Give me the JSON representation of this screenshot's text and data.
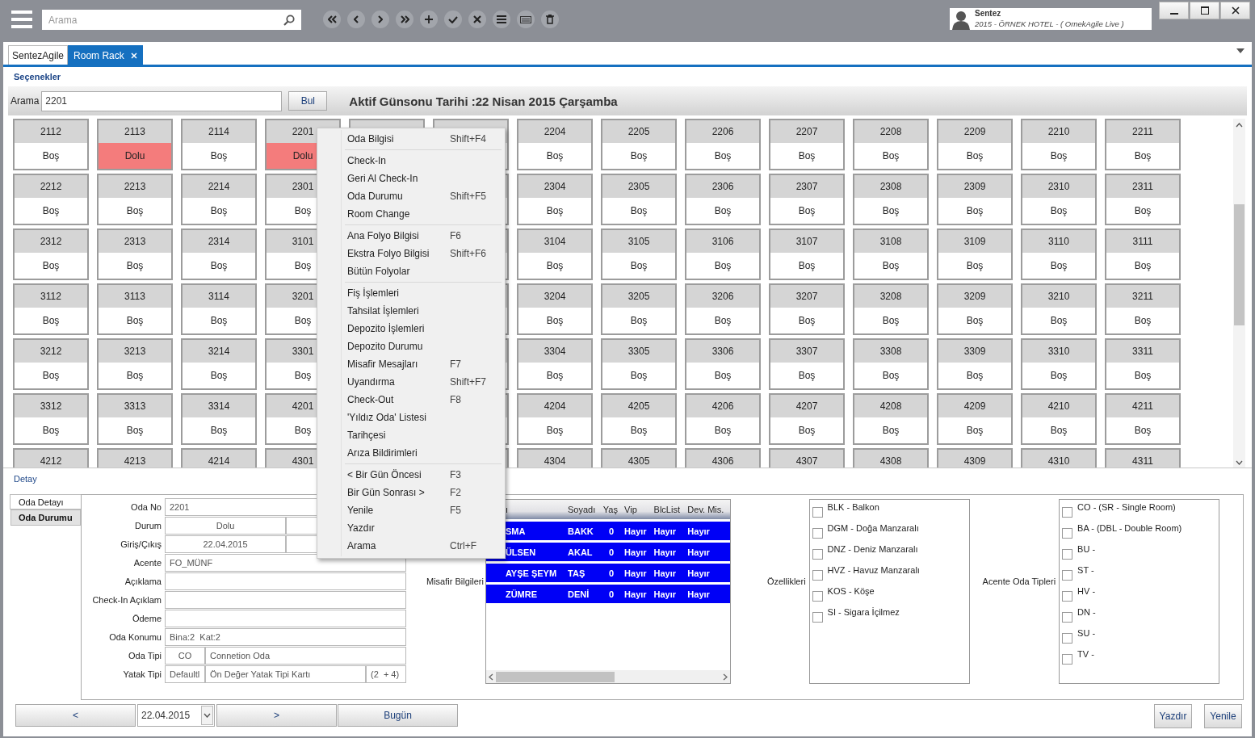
{
  "top_bar": {
    "search_placeholder": "Arama",
    "user": {
      "name": "Sentez",
      "context": "2015 - ÖRNEK HOTEL - ( OrnekAgile Live )"
    }
  },
  "tabs": [
    {
      "label": "SentezAgile",
      "selected": false,
      "closable": false
    },
    {
      "label": "Room Rack",
      "selected": true,
      "closable": true
    }
  ],
  "options_link": "Seçenekler",
  "search": {
    "label": "Arama",
    "value": "2201",
    "button": "Bul"
  },
  "active_date": "Aktif Günsonu Tarihi :22 Nisan 2015 Çarşamba",
  "room_rows": [
    [
      {
        "kind": "room",
        "number": "2112",
        "status": "Boş",
        "occupied": false
      },
      {
        "kind": "room",
        "number": "2113",
        "status": "Dolu",
        "occupied": true
      },
      {
        "kind": "room",
        "number": "2114",
        "status": "Boş",
        "occupied": false
      },
      {
        "kind": "room",
        "number": "2201",
        "status": "Dolu",
        "occupied": true
      },
      {
        "kind": "covered"
      },
      {
        "kind": "covered"
      },
      {
        "kind": "room",
        "number": "2204",
        "status": "Boş",
        "occupied": false
      },
      {
        "kind": "room",
        "number": "2205",
        "status": "Boş",
        "occupied": false
      },
      {
        "kind": "room",
        "number": "2206",
        "status": "Boş",
        "occupied": false
      },
      {
        "kind": "room",
        "number": "2207",
        "status": "Boş",
        "occupied": false
      },
      {
        "kind": "room",
        "number": "2208",
        "status": "Boş",
        "occupied": false
      },
      {
        "kind": "room",
        "number": "2209",
        "status": "Boş",
        "occupied": false
      },
      {
        "kind": "room",
        "number": "2210",
        "status": "Boş",
        "occupied": false
      },
      {
        "kind": "room",
        "number": "2211",
        "status": "Boş",
        "occupied": false
      }
    ],
    [
      {
        "kind": "room",
        "number": "2212",
        "status": "Boş",
        "occupied": false
      },
      {
        "kind": "room",
        "number": "2213",
        "status": "Boş",
        "occupied": false
      },
      {
        "kind": "room",
        "number": "2214",
        "status": "Boş",
        "occupied": false
      },
      {
        "kind": "room",
        "number": "2301",
        "status": "Boş",
        "occupied": false
      },
      {
        "kind": "hidden"
      },
      {
        "kind": "covered"
      },
      {
        "kind": "room",
        "number": "2304",
        "status": "Boş",
        "occupied": false
      },
      {
        "kind": "room",
        "number": "2305",
        "status": "Boş",
        "occupied": false
      },
      {
        "kind": "room",
        "number": "2306",
        "status": "Boş",
        "occupied": false
      },
      {
        "kind": "room",
        "number": "2307",
        "status": "Boş",
        "occupied": false
      },
      {
        "kind": "room",
        "number": "2308",
        "status": "Boş",
        "occupied": false
      },
      {
        "kind": "room",
        "number": "2309",
        "status": "Boş",
        "occupied": false
      },
      {
        "kind": "room",
        "number": "2310",
        "status": "Boş",
        "occupied": false
      },
      {
        "kind": "room",
        "number": "2311",
        "status": "Boş",
        "occupied": false
      }
    ],
    [
      {
        "kind": "room",
        "number": "2312",
        "status": "Boş",
        "occupied": false
      },
      {
        "kind": "room",
        "number": "2313",
        "status": "Boş",
        "occupied": false
      },
      {
        "kind": "room",
        "number": "2314",
        "status": "Boş",
        "occupied": false
      },
      {
        "kind": "room",
        "number": "3101",
        "status": "Boş",
        "occupied": false
      },
      {
        "kind": "hidden"
      },
      {
        "kind": "covered"
      },
      {
        "kind": "room",
        "number": "3104",
        "status": "Boş",
        "occupied": false
      },
      {
        "kind": "room",
        "number": "3105",
        "status": "Boş",
        "occupied": false
      },
      {
        "kind": "room",
        "number": "3106",
        "status": "Boş",
        "occupied": false
      },
      {
        "kind": "room",
        "number": "3107",
        "status": "Boş",
        "occupied": false
      },
      {
        "kind": "room",
        "number": "3108",
        "status": "Boş",
        "occupied": false
      },
      {
        "kind": "room",
        "number": "3109",
        "status": "Boş",
        "occupied": false
      },
      {
        "kind": "room",
        "number": "3110",
        "status": "Boş",
        "occupied": false
      },
      {
        "kind": "room",
        "number": "3111",
        "status": "Boş",
        "occupied": false
      }
    ],
    [
      {
        "kind": "room",
        "number": "3112",
        "status": "Boş",
        "occupied": false
      },
      {
        "kind": "room",
        "number": "3113",
        "status": "Boş",
        "occupied": false
      },
      {
        "kind": "room",
        "number": "3114",
        "status": "Boş",
        "occupied": false
      },
      {
        "kind": "room",
        "number": "3201",
        "status": "Boş",
        "occupied": false
      },
      {
        "kind": "hidden"
      },
      {
        "kind": "covered"
      },
      {
        "kind": "room",
        "number": "3204",
        "status": "Boş",
        "occupied": false
      },
      {
        "kind": "room",
        "number": "3205",
        "status": "Boş",
        "occupied": false
      },
      {
        "kind": "room",
        "number": "3206",
        "status": "Boş",
        "occupied": false
      },
      {
        "kind": "room",
        "number": "3207",
        "status": "Boş",
        "occupied": false
      },
      {
        "kind": "room",
        "number": "3208",
        "status": "Boş",
        "occupied": false
      },
      {
        "kind": "room",
        "number": "3209",
        "status": "Boş",
        "occupied": false
      },
      {
        "kind": "room",
        "number": "3210",
        "status": "Boş",
        "occupied": false
      },
      {
        "kind": "room",
        "number": "3211",
        "status": "Boş",
        "occupied": false
      }
    ],
    [
      {
        "kind": "room",
        "number": "3212",
        "status": "Boş",
        "occupied": false
      },
      {
        "kind": "room",
        "number": "3213",
        "status": "Boş",
        "occupied": false
      },
      {
        "kind": "room",
        "number": "3214",
        "status": "Boş",
        "occupied": false
      },
      {
        "kind": "room",
        "number": "3301",
        "status": "Boş",
        "occupied": false
      },
      {
        "kind": "hidden"
      },
      {
        "kind": "covered"
      },
      {
        "kind": "room",
        "number": "3304",
        "status": "Boş",
        "occupied": false
      },
      {
        "kind": "room",
        "number": "3305",
        "status": "Boş",
        "occupied": false
      },
      {
        "kind": "room",
        "number": "3306",
        "status": "Boş",
        "occupied": false
      },
      {
        "kind": "room",
        "number": "3307",
        "status": "Boş",
        "occupied": false
      },
      {
        "kind": "room",
        "number": "3308",
        "status": "Boş",
        "occupied": false
      },
      {
        "kind": "room",
        "number": "3309",
        "status": "Boş",
        "occupied": false
      },
      {
        "kind": "room",
        "number": "3310",
        "status": "Boş",
        "occupied": false
      },
      {
        "kind": "room",
        "number": "3311",
        "status": "Boş",
        "occupied": false
      }
    ],
    [
      {
        "kind": "room",
        "number": "3312",
        "status": "Boş",
        "occupied": false
      },
      {
        "kind": "room",
        "number": "3313",
        "status": "Boş",
        "occupied": false
      },
      {
        "kind": "room",
        "number": "3314",
        "status": "Boş",
        "occupied": false
      },
      {
        "kind": "room",
        "number": "4201",
        "status": "Boş",
        "occupied": false
      },
      {
        "kind": "covered"
      },
      {
        "kind": "covered"
      },
      {
        "kind": "room",
        "number": "4204",
        "status": "Boş",
        "occupied": false
      },
      {
        "kind": "room",
        "number": "4205",
        "status": "Boş",
        "occupied": false
      },
      {
        "kind": "room",
        "number": "4206",
        "status": "Boş",
        "occupied": false
      },
      {
        "kind": "room",
        "number": "4207",
        "status": "Boş",
        "occupied": false
      },
      {
        "kind": "room",
        "number": "4208",
        "status": "Boş",
        "occupied": false
      },
      {
        "kind": "room",
        "number": "4209",
        "status": "Boş",
        "occupied": false
      },
      {
        "kind": "room",
        "number": "4210",
        "status": "Boş",
        "occupied": false
      },
      {
        "kind": "room",
        "number": "4211",
        "status": "Boş",
        "occupied": false
      }
    ],
    [
      {
        "kind": "room",
        "number": "4212"
      },
      {
        "kind": "room",
        "number": "4213"
      },
      {
        "kind": "room",
        "number": "4214"
      },
      {
        "kind": "room",
        "number": "4301"
      },
      {
        "kind": "covered"
      },
      {
        "kind": "covered"
      },
      {
        "kind": "room",
        "number": "4304"
      },
      {
        "kind": "room",
        "number": "4305"
      },
      {
        "kind": "room",
        "number": "4306"
      },
      {
        "kind": "room",
        "number": "4307"
      },
      {
        "kind": "room",
        "number": "4308"
      },
      {
        "kind": "room",
        "number": "4309"
      },
      {
        "kind": "room",
        "number": "4310"
      },
      {
        "kind": "room",
        "number": "4311"
      }
    ]
  ],
  "context_menu": [
    [
      {
        "label": "Oda Bilgisi",
        "shortcut": "Shift+F4"
      }
    ],
    [
      {
        "label": "Check-In"
      },
      {
        "label": "Geri Al Check-In"
      },
      {
        "label": "Oda Durumu",
        "shortcut": "Shift+F5"
      },
      {
        "label": "Room Change"
      }
    ],
    [
      {
        "label": "Ana Folyo Bilgisi",
        "shortcut": "F6"
      },
      {
        "label": "Ekstra Folyo Bilgisi",
        "shortcut": "Shift+F6"
      },
      {
        "label": "Bütün Folyolar"
      }
    ],
    [
      {
        "label": "Fiş İşlemleri"
      },
      {
        "label": "Tahsilat İşlemleri"
      },
      {
        "label": "Depozito İşlemleri"
      },
      {
        "label": "Depozito Durumu"
      },
      {
        "label": "Misafir Mesajları",
        "shortcut": "F7"
      },
      {
        "label": "Uyandırma",
        "shortcut": "Shift+F7"
      },
      {
        "label": "Check-Out",
        "shortcut": "F8"
      },
      {
        "label": "'Yıldız Oda' Listesi"
      },
      {
        "label": "Tarihçesi"
      },
      {
        "label": "Arıza Bildirimleri"
      }
    ],
    [
      {
        "label": "< Bir Gün Öncesi",
        "shortcut": "F3"
      },
      {
        "label": "Bir Gün Sonrası >",
        "shortcut": "F2"
      },
      {
        "label": "Yenile",
        "shortcut": "F5"
      },
      {
        "label": "Yazdır"
      },
      {
        "label": "Arama",
        "shortcut": "Ctrl+F"
      }
    ]
  ],
  "detail": {
    "title": "Detay",
    "side_tabs": [
      {
        "label": "Oda Detayı",
        "selected": true
      },
      {
        "label": "Oda Durumu",
        "selected": false
      }
    ],
    "fields": [
      {
        "label": "Oda No",
        "kind": "single",
        "values": [
          "2201"
        ]
      },
      {
        "label": "Durum",
        "kind": "pair",
        "values": [
          "Dolu"
        ]
      },
      {
        "label": "Giriş/Çıkış",
        "kind": "pair",
        "values": [
          "22.04.2015"
        ]
      },
      {
        "label": "Acente",
        "kind": "single",
        "values": [
          "FO_MÜNF"
        ]
      },
      {
        "label": "Açıklama",
        "kind": "single"
      },
      {
        "label": "Check-In Açıklam",
        "kind": "single"
      },
      {
        "label": "Ödeme",
        "kind": "single"
      },
      {
        "label": "Oda Konumu",
        "kind": "single",
        "values": [
          "Bina:2  Kat:2"
        ]
      },
      {
        "label": "Oda Tipi",
        "kind": "coded",
        "values": [
          "CO",
          "Connetion Oda"
        ]
      },
      {
        "label": "Yatak Tipi",
        "kind": "coded",
        "values": [
          "Defaultl",
          "Ön Değer Yatak Tipi Kartı",
          "(2  + 4)"
        ]
      }
    ],
    "guests": {
      "label": "Misafir Bilgileri",
      "columns": [
        "ı",
        "Soyadı",
        "Yaş",
        "Vip",
        "BlcList",
        "Dev. Mis."
      ],
      "rows": [
        [
          "SMA",
          "BAKK",
          "0",
          "Hayır",
          "Hayır",
          "Hayır"
        ],
        [
          "ÜLSEN",
          "AKAL",
          "0",
          "Hayır",
          "Hayır",
          "Hayır"
        ],
        [
          "AYŞE ŞEYM",
          "TAŞ",
          "0",
          "Hayır",
          "Hayır",
          "Hayır"
        ],
        [
          "ZÜMRE",
          "DENİ",
          "0",
          "Hayır",
          "Hayır",
          "Hayır"
        ]
      ]
    },
    "features": {
      "label": "Özellikleri",
      "items": [
        {
          "label": "BLK - Balkon",
          "checked": false
        },
        {
          "label": "DGM - Doğa Manzaralı",
          "checked": false
        },
        {
          "label": "DNZ - Deniz Manzaralı",
          "checked": false
        },
        {
          "label": "HVZ - Havuz Manzaralı",
          "checked": false
        },
        {
          "label": "KOS - Köşe",
          "checked": false
        },
        {
          "label": "SI - Sigara İçilmez",
          "checked": false
        }
      ]
    },
    "agency_room_types": {
      "label": "Acente Oda Tipleri",
      "items": [
        {
          "label": "CO - (SR - Single Room)",
          "checked": false
        },
        {
          "label": "BA - (DBL - Double Room)",
          "checked": false
        },
        {
          "label": "BU -",
          "checked": false
        },
        {
          "label": "ST -",
          "checked": false
        },
        {
          "label": "HV -",
          "checked": false
        },
        {
          "label": "DN -",
          "checked": false
        },
        {
          "label": "SU -",
          "checked": false
        },
        {
          "label": "TV -",
          "checked": false
        }
      ]
    }
  },
  "bottom_bar": {
    "previous": "<",
    "date": "22.04.2015",
    "next": ">",
    "today": "Bugün",
    "print": "Yazdır",
    "refresh": "Yenile"
  }
}
